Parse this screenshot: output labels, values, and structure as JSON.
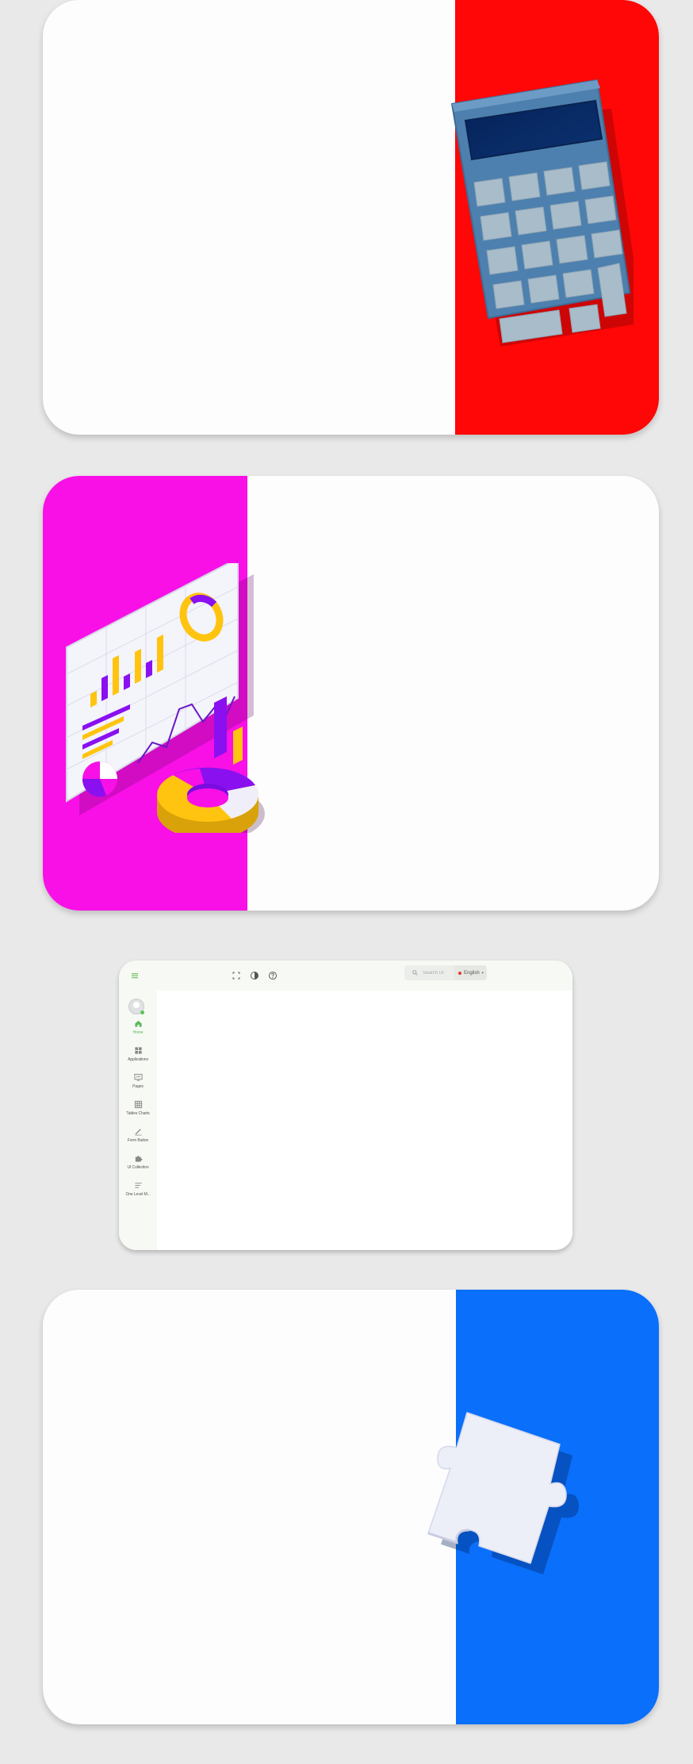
{
  "app": {
    "search": {
      "placeholder": "Search UI"
    },
    "language": {
      "selected": "English"
    },
    "sidebar": {
      "items": [
        {
          "label": "Home",
          "icon": "home-icon"
        },
        {
          "label": "Applications",
          "icon": "grid-icon"
        },
        {
          "label": "Pages",
          "icon": "page-monitor-icon"
        },
        {
          "label": "Tables Charts",
          "icon": "table-icon"
        },
        {
          "label": "Form Button",
          "icon": "pencil-icon"
        },
        {
          "label": "UI Collection",
          "icon": "puzzle-icon"
        },
        {
          "label": "One Level M...",
          "icon": "text-lines-icon"
        }
      ]
    },
    "toolbar_icons": [
      "menu-toggle-icon",
      "fullscreen-icon",
      "contrast-icon",
      "help-icon"
    ]
  },
  "illustrations": [
    {
      "name": "calculator",
      "icon": "calculator-icon",
      "panel_color": "#ff0707"
    },
    {
      "name": "analytics-dashboard",
      "icon": "dashboard-chart-icon",
      "panel_color": "#f810e6"
    },
    {
      "name": "puzzle-piece",
      "icon": "puzzle-piece-icon",
      "panel_color": "#0a6ffa"
    }
  ],
  "colors": {
    "page_background": "#e9e9e9",
    "card_background": "#fdfdfd",
    "accent_green": "#5cb85c",
    "sidebar_background": "#f7faf4"
  }
}
